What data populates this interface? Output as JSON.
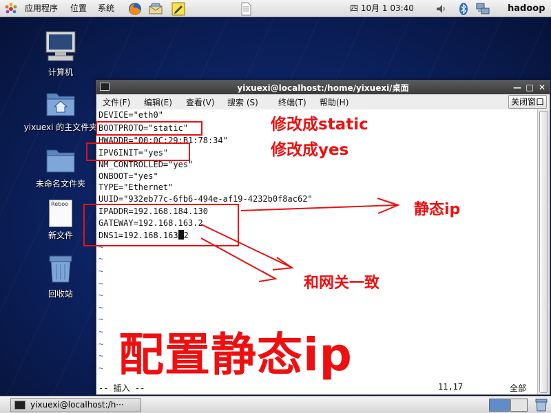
{
  "top_panel": {
    "applications": "应用程序",
    "places": "位置",
    "system": "系统",
    "clock": "四 10月  1 03:40",
    "username": "hadoop"
  },
  "desktop_icons": {
    "computer": "计算机",
    "home": "yixuexi 的主文件夹",
    "untitled_folder": "未命名文件夹",
    "new_file": "新文件",
    "new_file_thumb": "Reboo",
    "trash": "回收站"
  },
  "terminal": {
    "title": "yixuexi@localhost:/home/yixuexi/桌面",
    "menus": [
      "文件(F)",
      "编辑(E)",
      "查看(V)",
      "搜索 (S)",
      "终端(T)",
      "帮助(H)"
    ],
    "close_tab": "关闭窗口",
    "lines": [
      "DEVICE=\"eth0\"",
      "BOOTPROTO=\"static\"",
      "HWADDR=\"00:0C:29:B1:78:34\"",
      "IPV6INIT=\"yes\"",
      "NM_CONTROLLED=\"yes\"",
      "ONBOOT=\"yes\"",
      "TYPE=\"Ethernet\"",
      "UUID=\"932eb77c-6fb6-494e-af19-4232b0f8ac62\"",
      "IPADDR=192.168.184.130",
      "GATEWAY=192.168.163.2"
    ],
    "dns_line_before_cursor": "DNS1=192.168.163",
    "dns_line_after_cursor": "2",
    "tilde": "~",
    "status_mode": "-- 插入 --",
    "status_position": "11,17",
    "status_all": "全部"
  },
  "annotations": {
    "static_note": "修改成static",
    "yes_note": "修改成yes",
    "static_ip_note": "静态ip",
    "gateway_note": "和网关一致",
    "big_title": "配置静态ip"
  },
  "taskbar": {
    "terminal_task": "yixuexi@localhost:/h···"
  },
  "colors": {
    "annotation_red": "#ee1010",
    "tilde_blue": "#3060d0"
  }
}
